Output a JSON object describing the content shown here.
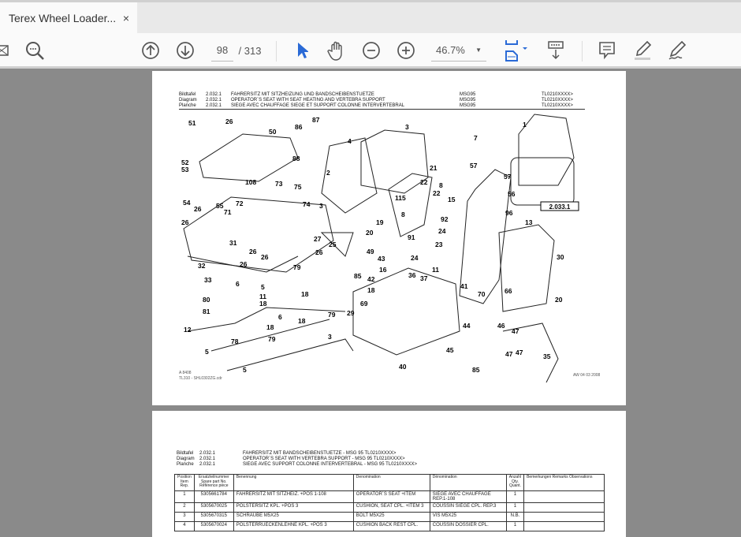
{
  "tab": {
    "title": "Terex Wheel Loader...",
    "close": "×"
  },
  "toolbar": {
    "page_current": "98",
    "page_total": "/ 313",
    "zoom": "46.7%"
  },
  "page1": {
    "header": [
      {
        "label": "Bildtafel",
        "num": "2.032.1",
        "title": "FAHRERSITZ MIT SITZHEIZUNG UND BANDSCHEIBENSTUETZE",
        "model": "MSG95",
        "serial": "TL0210XXXX>"
      },
      {
        "label": "Diagram",
        "num": "2.032.1",
        "title": "OPERATOR´S SEAT WITH SEAT HEATING AND VERTEBRA SUPPORT",
        "model": "MSG95",
        "serial": "TL0210XXXX>"
      },
      {
        "label": "Planche",
        "num": "2.032.1",
        "title": "SIEGE AVEC CHAUFFAGE SIEGE ET SUPPORT COLONNE INTERVERTEBRAL",
        "model": "MSG95",
        "serial": "TL0210XXXX>"
      }
    ],
    "ref_box": "2.033.1",
    "footer_left": "A 8408\nTL310 - SHL0302ZG.cdr",
    "footer_right": "AW 04 03 2008",
    "callouts": [
      "51",
      "26",
      "50",
      "86",
      "87",
      "88",
      "4",
      "3",
      "1",
      "7",
      "2",
      "57",
      "57",
      "21",
      "22",
      "8",
      "22",
      "15",
      "52",
      "53",
      "108",
      "73",
      "75",
      "54",
      "26",
      "55",
      "72",
      "74",
      "3",
      "115",
      "56",
      "96",
      "19",
      "8",
      "92",
      "13",
      "26",
      "71",
      "20",
      "91",
      "24",
      "30",
      "31",
      "27",
      "25",
      "26",
      "49",
      "23",
      "24",
      "32",
      "26",
      "26",
      "26",
      "79",
      "43",
      "16",
      "42",
      "85",
      "36",
      "37",
      "11",
      "41",
      "18",
      "70",
      "33",
      "6",
      "11",
      "18",
      "5",
      "18",
      "69",
      "80",
      "81",
      "29",
      "6",
      "18",
      "44",
      "46",
      "47",
      "66",
      "20",
      "12",
      "18",
      "79",
      "79",
      "78",
      "45",
      "47",
      "47",
      "5",
      "35",
      "40",
      "85",
      "5",
      "3"
    ]
  },
  "page2": {
    "header": [
      {
        "label": "Bildtafel",
        "num": "2.032.1",
        "title": "FAHRERSITZ MIT BANDSCHEIBENSTUETZE - MSG 95   TL0210XXXX>"
      },
      {
        "label": "Diagram",
        "num": "2.032.1",
        "title": "OPERATOR´S SEAT WITH VERTEBRA SUPPORT - MSG 95   TL0210XXXX>"
      },
      {
        "label": "Planche",
        "num": "2.032.1",
        "title": "SIEGE AVEC SUPPORT COLONNE INTERVERTEBRAL - MSG 95   TL0210XXXX>"
      }
    ],
    "columns": [
      "Position Item Rep.",
      "Ersatzteilnummer Spare part No. Référence pièce",
      "Benennung",
      "Denomination",
      "Dénomination",
      "Anzahl Qty. Quant.",
      "Bemerkungen Remarks Observations"
    ],
    "rows": [
      [
        "1",
        "5305661784",
        "FAHRERSITZ MIT SITZHEIZ. +POS 1-108",
        "OPERATOR´S SEAT +ITEM",
        "SIEGE AVEC CHAUFFAGE REP.1-108",
        "1",
        ""
      ],
      [
        "2",
        "5305670025",
        "POLSTERSITZ KPL. +POS 3",
        "CUSHION, SEAT CPL. +ITEM 3",
        "COUSSIN SIÈGE CPL. REP.3",
        "1",
        ""
      ],
      [
        "3",
        "5305670315",
        "SCHRAUBE M5X25",
        "BOLT M5X25",
        "VIS M5X25",
        "N.B.",
        ""
      ],
      [
        "4",
        "5305670024",
        "POLSTERRUECKENLEHNE KPL. +POS 3",
        "CUSHION BACK REST CPL.",
        "COUSSIN DOSSIER CPL.",
        "1",
        ""
      ]
    ]
  }
}
